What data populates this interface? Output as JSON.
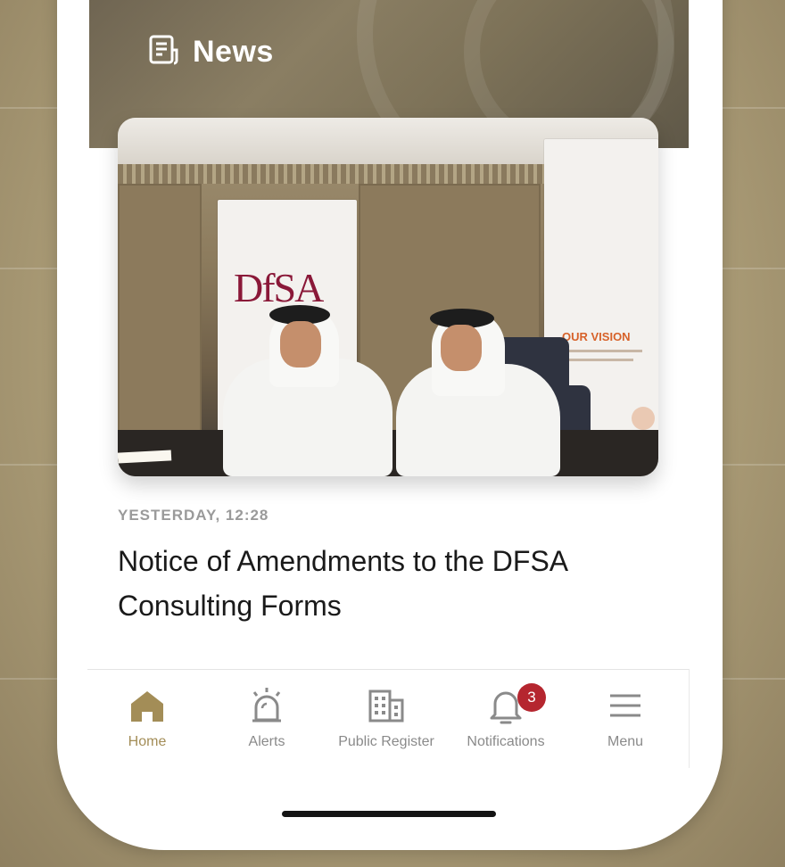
{
  "header": {
    "title": "News",
    "icon": "news-icon"
  },
  "article": {
    "timestamp": "YESTERDAY, 12:28",
    "headline": "Notice of Amendments to the DFSA Consulting Forms",
    "photo": {
      "banner_logo": "DfSA",
      "banner2_vision": "OUR VISION"
    }
  },
  "tabbar": {
    "items": [
      {
        "label": "Home",
        "icon": "home-icon",
        "active": true
      },
      {
        "label": "Alerts",
        "icon": "alarm-icon",
        "active": false
      },
      {
        "label": "Public Register",
        "icon": "building-icon",
        "active": false
      },
      {
        "label": "Notifications",
        "icon": "bell-icon",
        "active": false,
        "badge": "3"
      },
      {
        "label": "Menu",
        "icon": "hamburger-icon",
        "active": false
      }
    ]
  },
  "colors": {
    "accent": "#a38d57",
    "badge": "#b5262f",
    "inactive": "#8a8a8a"
  }
}
